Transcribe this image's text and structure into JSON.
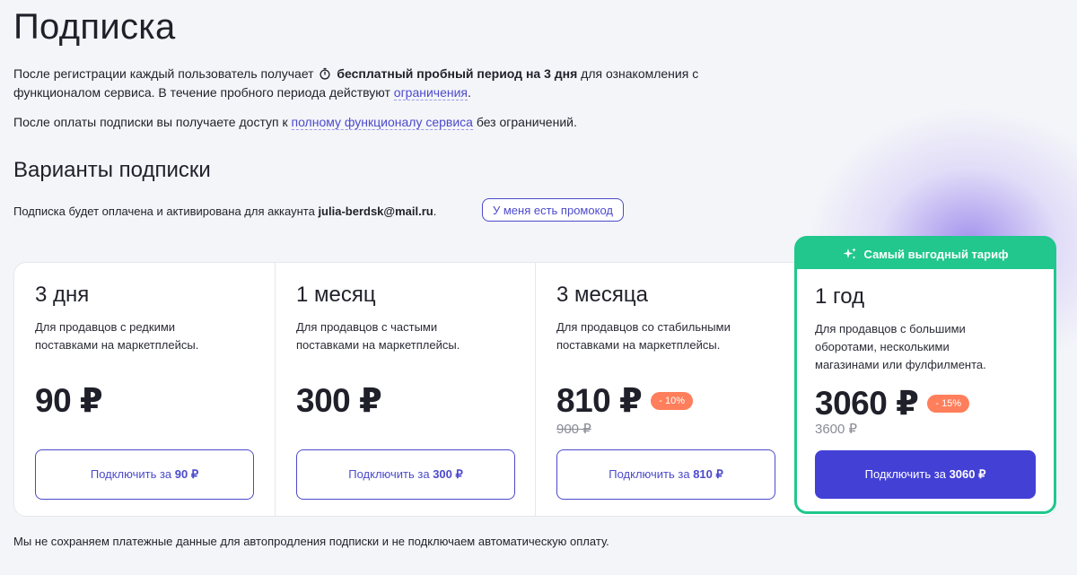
{
  "header": {
    "title": "Подписка"
  },
  "intro": {
    "part1": "После регистрации каждый пользователь получает",
    "bold": "бесплатный пробный период на 3 дня",
    "part2": "для ознакомления с функционалом сервиса. В течение пробного периода действуют",
    "limits_link": "ограничения",
    "end": ".",
    "line2_part1": "После оплаты подписки вы получаете доступ к",
    "full_link": "полному функционалу сервиса",
    "line2_part2": "без ограничений."
  },
  "options": {
    "title": "Варианты подписки",
    "account_text": "Подписка будет оплачена и активирована для аккаунта",
    "account_email": "julia-berdsk@mail.ru",
    "account_end": ".",
    "promo_button": "У меня есть промокод"
  },
  "plans": [
    {
      "title": "3 дня",
      "description": "Для продавцов с редкими поставками на маркетплейсы.",
      "price": "90 ₽",
      "discount": "",
      "old_price": "",
      "button_prefix": "Подключить за",
      "button_price": "90 ₽"
    },
    {
      "title": "1 месяц",
      "description": "Для продавцов с частыми поставками на маркетплейсы.",
      "price": "300 ₽",
      "discount": "",
      "old_price": "",
      "button_prefix": "Подключить за",
      "button_price": "300 ₽"
    },
    {
      "title": "3 месяца",
      "description": "Для продавцов со стабильными поставками на маркетплейсы.",
      "price": "810 ₽",
      "discount": "- 10%",
      "old_price": "900 ₽",
      "button_prefix": "Подключить за",
      "button_price": "810 ₽"
    },
    {
      "title": "1 год",
      "description": "Для продавцов с большими оборотами, несколькими магазинами или фулфилмента.",
      "price": "3060 ₽",
      "discount": "- 15%",
      "old_price": "3600 ₽",
      "button_prefix": "Подключить за",
      "button_price": "3060 ₽",
      "badge": "Самый выгодный тариф"
    }
  ],
  "footer": {
    "note": "Мы не сохраняем платежные данные для автопродления подписки и не подключаем автоматическую оплату."
  },
  "colors": {
    "accent": "#4c4acb",
    "primary_button": "#4340d6",
    "featured": "#21c78c",
    "discount": "#ff7e5b",
    "text": "#1f2029",
    "background": "#f4f5f9"
  },
  "icons": {
    "trial": "timer-icon",
    "badge": "sparkle-icon"
  }
}
